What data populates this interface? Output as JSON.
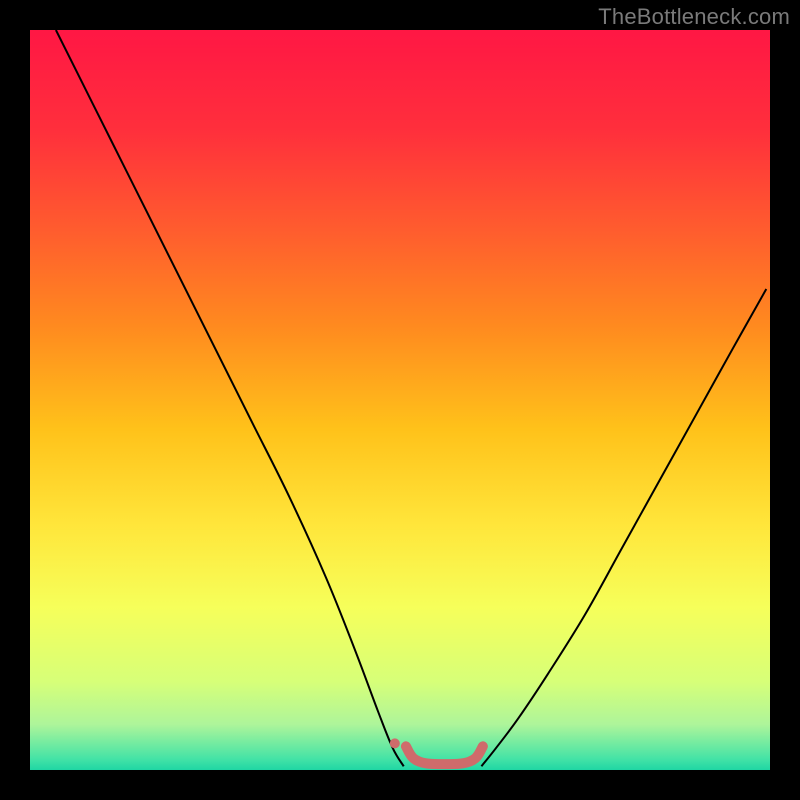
{
  "watermark": "TheBottleneck.com",
  "chart_data": {
    "type": "line",
    "title": "",
    "xlabel": "",
    "ylabel": "",
    "xlim": [
      0,
      100
    ],
    "ylim": [
      0,
      100
    ],
    "grid": false,
    "legend": false,
    "background_gradient_stops": [
      {
        "offset": 0.0,
        "color": "#ff1744"
      },
      {
        "offset": 0.135,
        "color": "#ff2f3c"
      },
      {
        "offset": 0.27,
        "color": "#ff5c2e"
      },
      {
        "offset": 0.4,
        "color": "#ff8a1f"
      },
      {
        "offset": 0.54,
        "color": "#ffc21a"
      },
      {
        "offset": 0.67,
        "color": "#ffe63b"
      },
      {
        "offset": 0.78,
        "color": "#f6ff5a"
      },
      {
        "offset": 0.88,
        "color": "#d7ff78"
      },
      {
        "offset": 0.938,
        "color": "#aef59a"
      },
      {
        "offset": 0.985,
        "color": "#44e3a6"
      },
      {
        "offset": 1.0,
        "color": "#1fd6a4"
      }
    ],
    "series": [
      {
        "name": "bottleneck-curve-left",
        "stroke": "#000000",
        "stroke_width": 2,
        "x": [
          3.5,
          7,
          11,
          15,
          20,
          25,
          30,
          35,
          40,
          44,
          47,
          49,
          50.5
        ],
        "y": [
          100,
          93,
          85,
          77,
          67,
          57,
          47,
          37,
          26,
          16,
          8,
          3,
          0.5
        ]
      },
      {
        "name": "bottleneck-curve-right",
        "stroke": "#000000",
        "stroke_width": 2,
        "x": [
          61,
          63,
          66,
          70,
          75,
          80,
          85,
          90,
          95,
          99.5
        ],
        "y": [
          0.5,
          3,
          7,
          13,
          21,
          30,
          39,
          48,
          57,
          65
        ]
      },
      {
        "name": "optimum-marker",
        "stroke": "#cf6b6b",
        "stroke_width": 10,
        "linecap": "round",
        "x": [
          50.8,
          51.8,
          53.5,
          56,
          58.5,
          60.2,
          61.2
        ],
        "y": [
          3.2,
          1.6,
          0.9,
          0.8,
          0.9,
          1.6,
          3.2
        ]
      }
    ],
    "markers": [
      {
        "name": "optimum-dot",
        "x": 49.3,
        "y": 3.6,
        "r": 5,
        "fill": "#cf6b6b"
      }
    ]
  }
}
